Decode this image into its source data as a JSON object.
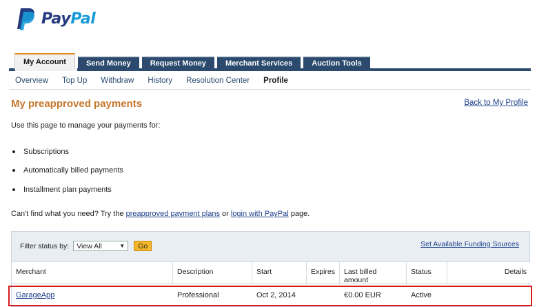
{
  "brand": {
    "part1": "Pay",
    "part2": "Pal",
    "color_dark": "#253b80",
    "color_light": "#179bd7"
  },
  "tabs": [
    {
      "label": "My Account",
      "active": true
    },
    {
      "label": "Send Money",
      "active": false
    },
    {
      "label": "Request Money",
      "active": false
    },
    {
      "label": "Merchant Services",
      "active": false
    },
    {
      "label": "Auction Tools",
      "active": false
    }
  ],
  "subnav": [
    {
      "label": "Overview"
    },
    {
      "label": "Top Up"
    },
    {
      "label": "Withdraw"
    },
    {
      "label": "History"
    },
    {
      "label": "Resolution Center"
    },
    {
      "label": "Profile",
      "current": true
    }
  ],
  "page": {
    "title": "My preapproved payments",
    "back_link": "Back to My Profile",
    "intro": "Use this page to manage your payments for:",
    "bullets": [
      "Subscriptions",
      "Automatically billed payments",
      "Installment plan payments"
    ],
    "help_prefix": "Can't find what you need? Try the ",
    "help_link1": "preapproved payment plans",
    "help_mid": " or ",
    "help_link2": "login with PayPal",
    "help_suffix": " page."
  },
  "filter": {
    "label": "Filter status by:",
    "selected": "View All",
    "go_label": "Go",
    "funding_link": "Set Available Funding Sources"
  },
  "table": {
    "headers": [
      "Merchant",
      "Description",
      "Start",
      "Expires",
      "Last billed amount",
      "Status",
      "Details"
    ],
    "rows": [
      {
        "merchant": "GarageApp",
        "description": "Professional",
        "start": "Oct 2, 2014",
        "expires": "",
        "last_billed": "€0.00 EUR",
        "status": "Active",
        "details": ""
      }
    ]
  },
  "colors": {
    "accent_orange": "#c5762a",
    "nav_blue": "#2b4a6e",
    "link_blue": "#1b3f8c",
    "highlight_red": "#d71a1a",
    "go_button": "#f5b82b"
  }
}
